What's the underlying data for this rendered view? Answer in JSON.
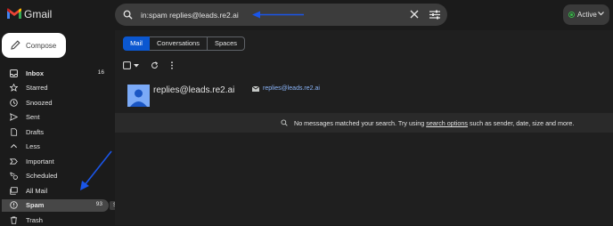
{
  "app": {
    "title": "Gmail"
  },
  "search": {
    "query": "in:spam replies@leads.re2.ai"
  },
  "status": {
    "label": "Active"
  },
  "compose": {
    "label": "Compose"
  },
  "sidebar": {
    "items": [
      {
        "label": "Inbox",
        "count": "16",
        "bold": true
      },
      {
        "label": "Starred",
        "count": ""
      },
      {
        "label": "Snoozed",
        "count": ""
      },
      {
        "label": "Sent",
        "count": ""
      },
      {
        "label": "Drafts",
        "count": ""
      },
      {
        "label": "Less",
        "count": ""
      },
      {
        "label": "Important",
        "count": ""
      },
      {
        "label": "Scheduled",
        "count": ""
      },
      {
        "label": "All Mail",
        "count": ""
      },
      {
        "label": "Spam",
        "count": "93",
        "bold": true,
        "selected": true
      },
      {
        "label": "Trash",
        "count": ""
      }
    ],
    "tooltip": "Spam"
  },
  "tabs": {
    "mail": "Mail",
    "conversations": "Conversations",
    "spaces": "Spaces"
  },
  "result": {
    "name": "replies@leads.re2.ai",
    "email": "replies@leads.re2.ai"
  },
  "empty": {
    "before": "No messages matched your search. Try using ",
    "link": "search options",
    "after": " such as sender, date, size and more."
  },
  "colors": {
    "accent": "#0b57d0",
    "annotation_arrow": "#1a55e8",
    "status_active": "#39b54a"
  }
}
